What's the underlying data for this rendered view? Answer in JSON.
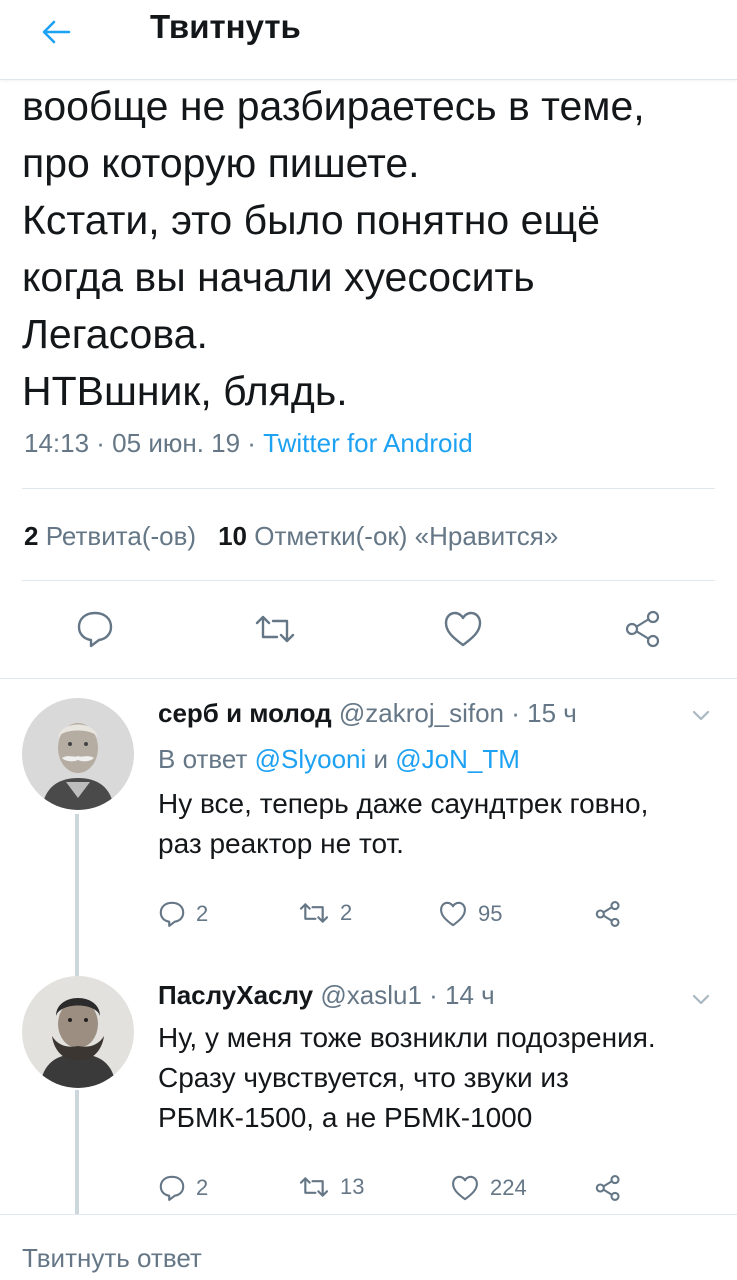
{
  "header": {
    "title": "Твитнуть"
  },
  "tweet": {
    "lines": [
      "вообще не разбираетесь в теме,",
      "про которую пишете.",
      "Кстати, это было понятно ещё",
      "когда вы начали хуесосить",
      "Легасова.",
      "НТВшник, блядь."
    ],
    "timestamp": "14:13 · 05 июн. 19 · ",
    "source": "Twitter for Android",
    "retweets_count": "2",
    "retweets_label": "Ретвита(-ов)",
    "likes_count": "10",
    "likes_label": "Отметки(-ок) «Нравится»"
  },
  "replies": [
    {
      "name": "серб и молод",
      "handle": "@zakroj_sifon",
      "time": " · 15 ч",
      "reply_prefix": "В ответ ",
      "reply_mention_1": "@Slyooni",
      "reply_and": " и ",
      "reply_mention_2": "@JoN_TM",
      "text_lines": [
        "Ну все, теперь даже саундтрек говно,",
        "раз реактор не тот."
      ],
      "reply_count": "2",
      "retweet_count": "2",
      "like_count": "95"
    },
    {
      "name": "ПаслуХаслу",
      "handle": "@xaslu1",
      "time": " · 14 ч",
      "text_lines": [
        "Ну, у меня тоже возникли подозрения.",
        "Сразу чувствуется, что звуки из",
        "РБМК-1500, а не РБМК-1000"
      ],
      "reply_count": "2",
      "retweet_count": "13",
      "like_count": "224"
    }
  ],
  "compose": {
    "placeholder": "Твитнуть ответ"
  },
  "colors": {
    "accent": "#1da1f2",
    "secondary_text": "#657786",
    "divider": "#e1e8ed"
  }
}
